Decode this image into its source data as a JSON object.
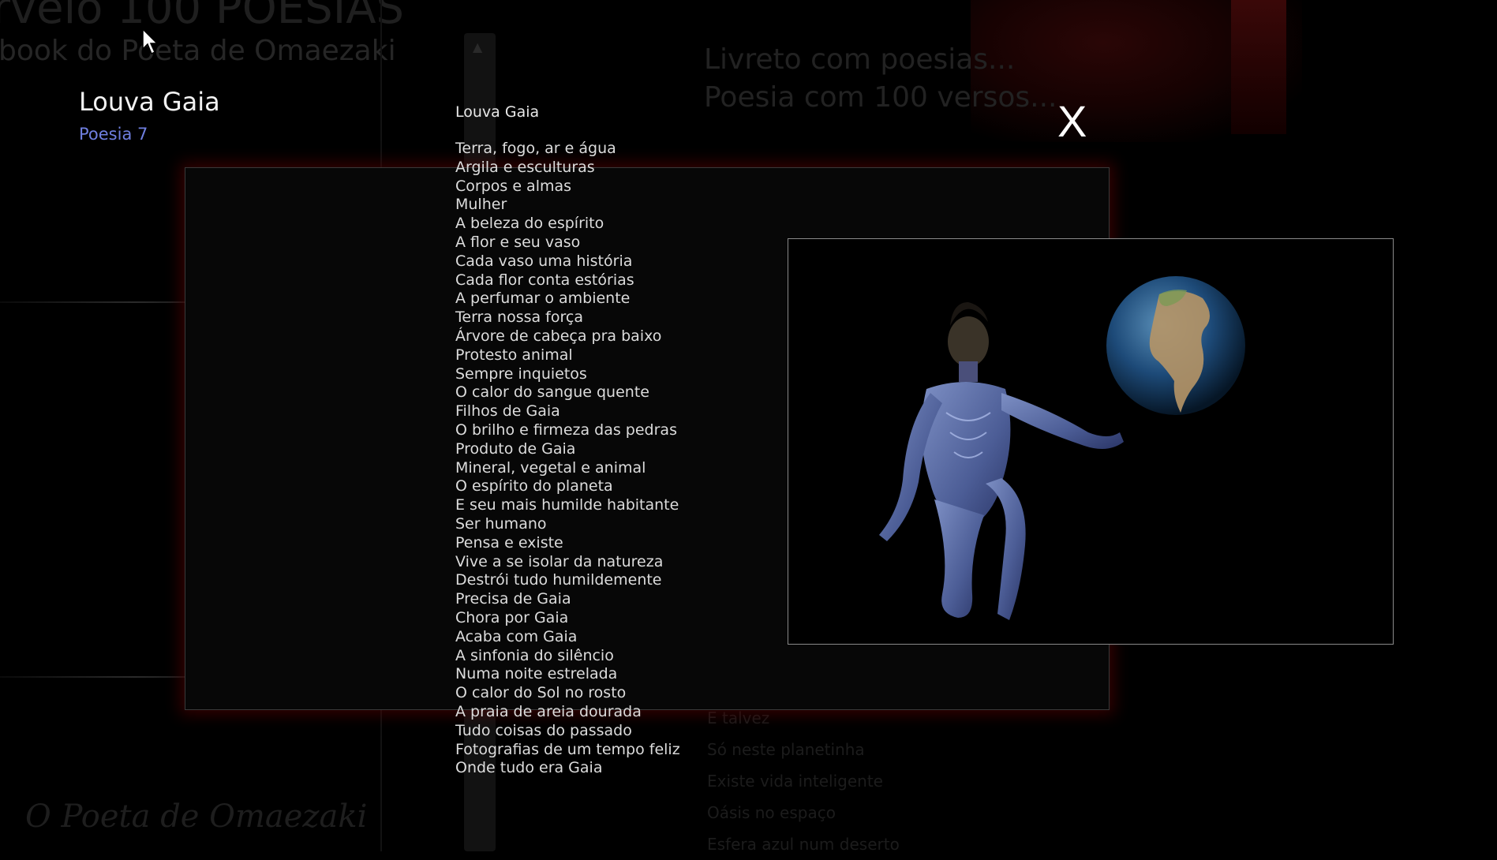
{
  "background": {
    "title": "rvelo 100 POESIAS",
    "subtitle": "book do Poeta de Omaezaki",
    "livreto_line1": "Livreto com poesias...",
    "livreto_line2": "Poesia com 100 versos...",
    "quote_line1": "O Poeta de Omaezaki",
    "quote_line2": "",
    "red_text": "",
    "list": [
      "E talvez",
      "Só neste planetinha",
      "Existe vida inteligente",
      "Oásis no espaço",
      "Esfera azul num deserto"
    ]
  },
  "popup": {
    "heading": "Louva Gaia",
    "number": "Poesia 7",
    "close_label": "X",
    "poem_title": "Louva Gaia",
    "poem_lines": [
      "Terra, fogo, ar e água",
      "Argila e esculturas",
      "Corpos e almas",
      "Mulher",
      "A beleza do espírito",
      "A flor e seu vaso",
      "Cada vaso uma história",
      "Cada flor conta estórias",
      "A perfumar o ambiente",
      "Terra nossa força",
      "Árvore de cabeça pra baixo",
      "Protesto animal",
      "Sempre inquietos",
      "O calor do sangue quente",
      "Filhos de Gaia",
      "O brilho e firmeza das pedras",
      "Produto de Gaia",
      "Mineral, vegetal e animal",
      "O espírito do planeta",
      "E seu mais humilde habitante",
      "Ser humano",
      "Pensa e existe",
      "Vive a se isolar da natureza",
      "Destrói tudo humildemente",
      "Precisa de Gaia",
      "Chora por Gaia",
      "Acaba com Gaia",
      "A sinfonia do silêncio",
      "Numa noite estrelada",
      "O calor do Sol no rosto",
      "A praia de areia dourada",
      "Tudo coisas do passado",
      "Fotografias de um tempo feliz",
      "Onde tudo era Gaia"
    ]
  },
  "colors": {
    "accent_number": "#6f7fe0",
    "glow": "#5a0000"
  }
}
